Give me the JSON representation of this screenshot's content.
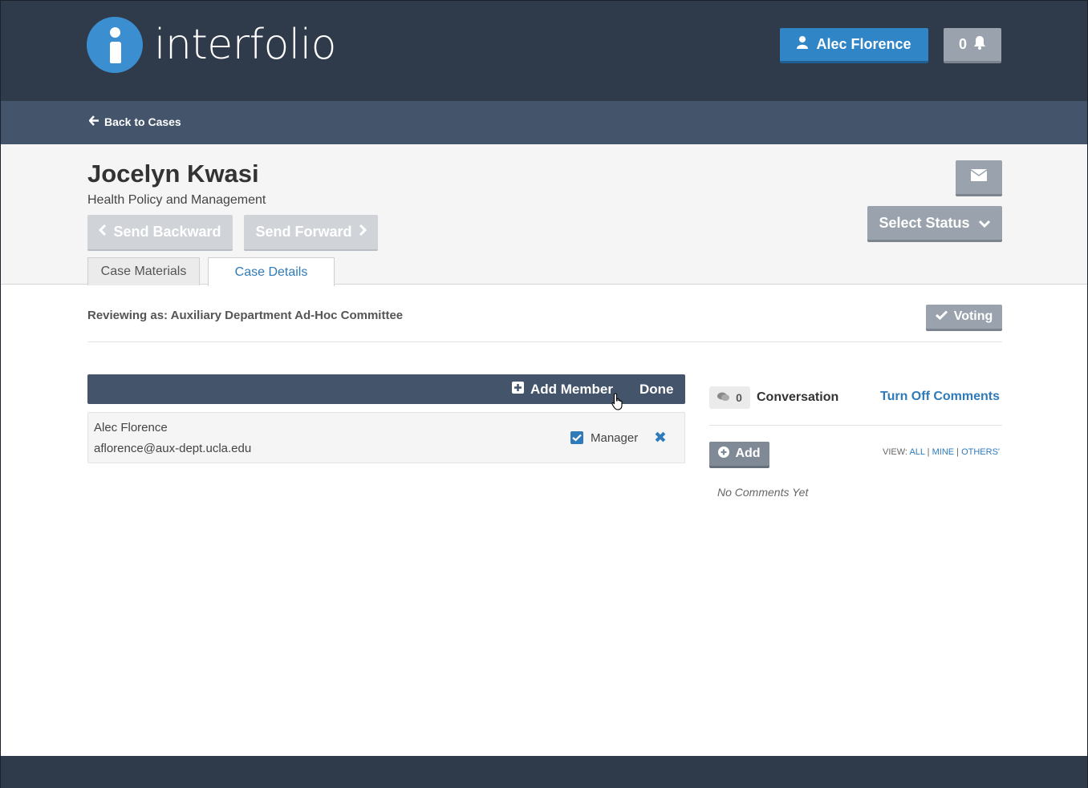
{
  "header": {
    "logo_text": "interfolio",
    "user_name": "Alec Florence",
    "notification_count": "0"
  },
  "subnav": {
    "back_label": "Back to Cases"
  },
  "case": {
    "name": "Jocelyn Kwasi",
    "department": "Health Policy and Management",
    "send_backward": "Send Backward",
    "send_forward": "Send Forward",
    "select_status": "Select Status",
    "tabs": [
      {
        "label": "Case Materials",
        "active": false
      },
      {
        "label": "Case Details",
        "active": true
      }
    ]
  },
  "details": {
    "reviewing_as": "Reviewing as: Auxiliary Department Ad-Hoc Committee",
    "voting_label": "Voting",
    "members": {
      "add_member_label": "Add Member",
      "done_label": "Done",
      "list": [
        {
          "name": "Alec Florence",
          "email": "aflorence@aux-dept.ucla.edu",
          "role": "Manager",
          "manager_checked": true
        }
      ]
    }
  },
  "comments": {
    "count": "0",
    "title": "Conversation",
    "turn_off_label": "Turn Off Comments",
    "add_label": "Add",
    "view_label": "VIEW:",
    "filters": [
      "ALL",
      "MINE",
      "OTHERS'"
    ],
    "empty_text": "No Comments Yet"
  },
  "colors": {
    "topbar": "#2f3a4a",
    "subnav": "#43546b",
    "accent_blue": "#2f85c6",
    "link_blue": "#2f7bb9",
    "gray_button": "#9aa3ad"
  }
}
